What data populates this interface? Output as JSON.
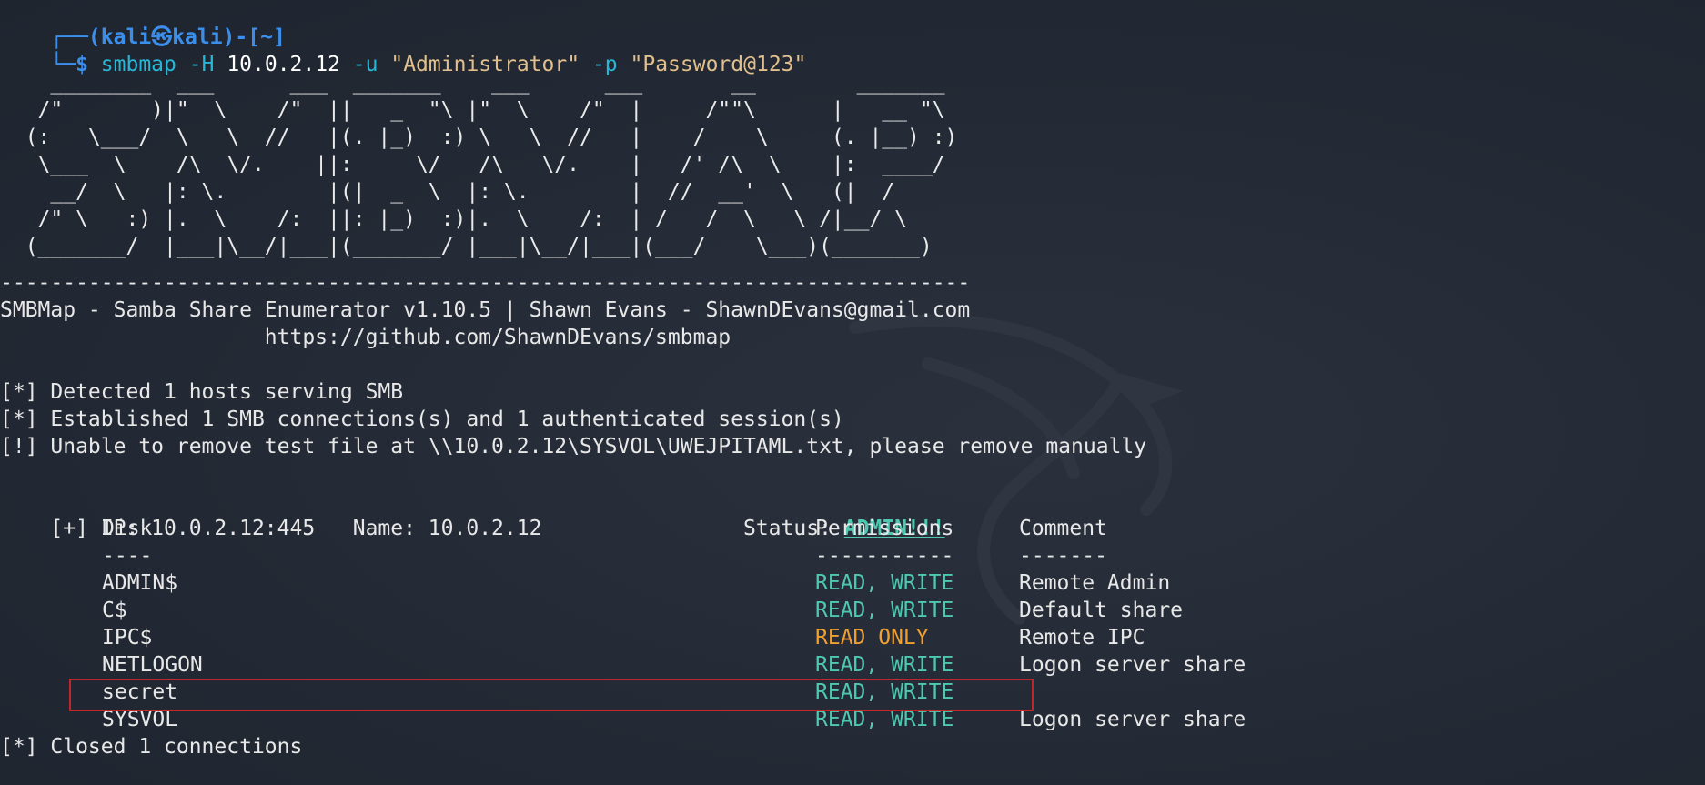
{
  "prompt": {
    "line1": "┌──(kali㉿kali)-[~]",
    "line2_symbol": "└─$",
    "cmd": "smbmap",
    "flag_h": "-H",
    "host": "10.0.2.12",
    "flag_u": "-u",
    "user": "\"Administrator\"",
    "flag_p": "-p",
    "password": "\"Password@123\""
  },
  "banner": {
    "ascii": "    ________  ___      ___  _______    ___      ___       __        _______\n   /\"       )|\"  \\    /\"  ||   _  \"\\ |\"  \\    /\"  |     /\"\"\\      |   __ \"\\\n  (:   \\___/  \\   \\  //   |(. |_)  :) \\   \\  //   |    /    \\     (. |__) :)\n   \\___  \\    /\\  \\/.    ||:     \\/   /\\   \\/.    |   /' /\\  \\    |:  ____/\n    __/  \\   |: \\.        |(|  _  \\  |: \\.        |  //  __'  \\   (|  /\n   /\" \\   :) |.  \\    /:  ||: |_)  :)|.  \\    /:  | /   /  \\   \\ /|__/ \\\n  (_______/  |___|\\__/|___|(_______/ |___|\\__/|___|(___/    \\___)(_______)",
    "separator": "-----------------------------------------------------------------------------",
    "title": "SMBMap - Samba Share Enumerator v1.10.5 | Shawn Evans - ShawnDEvans@gmail.com",
    "url": "                     https://github.com/ShawnDEvans/smbmap"
  },
  "messages": [
    "[*] Detected 1 hosts serving SMB",
    "[*] Established 1 SMB connections(s) and 1 authenticated session(s)",
    "[!] Unable to remove test file at \\\\10.0.2.12\\SYSVOL\\UWEJPITAML.txt, please remove manually"
  ],
  "host_line": {
    "prefix": "[+] IP: 10.0.2.12:445   Name: 10.0.2.12                Status: ",
    "status": "ADMIN!!!"
  },
  "table": {
    "headers": {
      "disk": "Disk",
      "permissions": "Permissions",
      "comment": "Comment"
    },
    "underlines": {
      "disk": "----",
      "permissions": "-----------",
      "comment": "-------"
    },
    "rows": [
      {
        "disk": "ADMIN$",
        "permissions": "READ, WRITE",
        "perm_type": "rw",
        "comment": "Remote Admin"
      },
      {
        "disk": "C$",
        "permissions": "READ, WRITE",
        "perm_type": "rw",
        "comment": "Default share"
      },
      {
        "disk": "IPC$",
        "permissions": "READ ONLY",
        "perm_type": "ro",
        "comment": "Remote IPC"
      },
      {
        "disk": "NETLOGON",
        "permissions": "READ, WRITE",
        "perm_type": "rw",
        "comment": "Logon server share"
      },
      {
        "disk": "secret",
        "permissions": "READ, WRITE",
        "perm_type": "rw",
        "comment": ""
      },
      {
        "disk": "SYSVOL",
        "permissions": "READ, WRITE",
        "perm_type": "rw",
        "comment": "Logon server share"
      }
    ]
  },
  "footer": "[*] Closed 1 connections",
  "colors": {
    "background": "#232934",
    "prompt_blue": "#3b8eea",
    "command_cyan": "#28b6d6",
    "rw_green": "#4ec9b0",
    "ro_orange": "#f0a030",
    "highlight_red": "#c0262a"
  }
}
